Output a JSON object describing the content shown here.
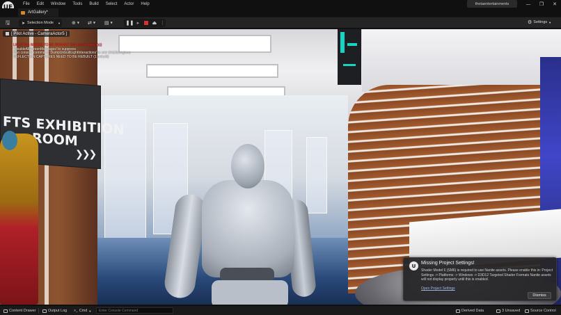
{
  "window": {
    "logo": "UE",
    "menu": [
      "File",
      "Edit",
      "Window",
      "Tools",
      "Build",
      "Select",
      "Actor",
      "Help"
    ],
    "account": "thetaentertainments",
    "controls": {
      "minimize": "—",
      "maximize": "❐",
      "close": "✕"
    }
  },
  "tab": {
    "label": "ArtGallery*"
  },
  "toolbar": {
    "selection_mode": "Selection Mode",
    "settings_label": "Settings"
  },
  "viewport": {
    "header_title": "[ Pilot Active - CameraActor5 ]",
    "messages": [
      {
        "text": "LIGHTING NEEDS TO BE REBUILT (58 unbuilt object(s))",
        "color": "red"
      },
      {
        "text": "'DisableAllScreenMessages' to suppress",
        "color": "white"
      },
      {
        "text": "Run console command 'DumpUnbuiltLightInteractions' to see details/regions",
        "color": "white"
      },
      {
        "text": "REFLECTION CAPTURES NEED TO BE REBUILT (1 unbuilt)",
        "color": "white"
      }
    ],
    "sign": {
      "line1": "FTS EXHIBITION",
      "line2": "ROOM",
      "arrows": "❯❯❯"
    }
  },
  "notification": {
    "title": "Missing Project Settings!",
    "body": "Shader Model 6 (SM6) is required to use Nanite assets. Please enable this in: Project Settings -> Platforms -> Windows -> D3D12 Targeted Shader Formats Nanite assets will not display properly until this is enabled.",
    "link": "Open Project Settings",
    "dismiss": "Dismiss"
  },
  "statusbar": {
    "content_drawer": "Content Drawer",
    "output_log": "Output Log",
    "cmd": "Cmd",
    "cmd_placeholder": "Enter Console Command",
    "derived_data": "Derived Data",
    "unsaved": "3 Unsaved",
    "source_control": "Source Control"
  }
}
